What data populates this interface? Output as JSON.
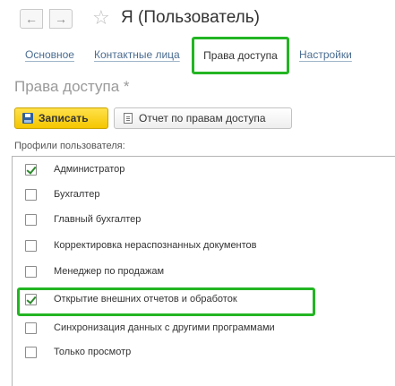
{
  "header": {
    "back_icon": "←",
    "forward_icon": "→",
    "star_icon": "☆",
    "title": "Я (Пользователь)"
  },
  "tabs": [
    {
      "label": "Основное",
      "active": false
    },
    {
      "label": "Контактные лица",
      "active": false
    },
    {
      "label": "Права доступа",
      "active": true
    },
    {
      "label": "Настройки",
      "active": false
    }
  ],
  "section": {
    "title": "Права доступа *"
  },
  "toolbar": {
    "save_label": "Записать",
    "report_label": "Отчет по правам доступа"
  },
  "profiles": {
    "label": "Профили пользователя:",
    "items": [
      {
        "label": "Администратор",
        "checked": true
      },
      {
        "label": "Бухгалтер",
        "checked": false
      },
      {
        "label": "Главный бухгалтер",
        "checked": false
      },
      {
        "label": "Корректировка нераспознанных документов",
        "checked": false
      },
      {
        "label": "Менеджер по продажам",
        "checked": false
      },
      {
        "label": "Открытие внешних отчетов и обработок",
        "checked": true
      },
      {
        "label": "Синхронизация данных с другими программами",
        "checked": false
      },
      {
        "label": "Только просмотр",
        "checked": false
      }
    ]
  },
  "colors": {
    "accent_highlight": "#23b523",
    "save_button": "#f5c600",
    "link": "#4b6d91"
  }
}
